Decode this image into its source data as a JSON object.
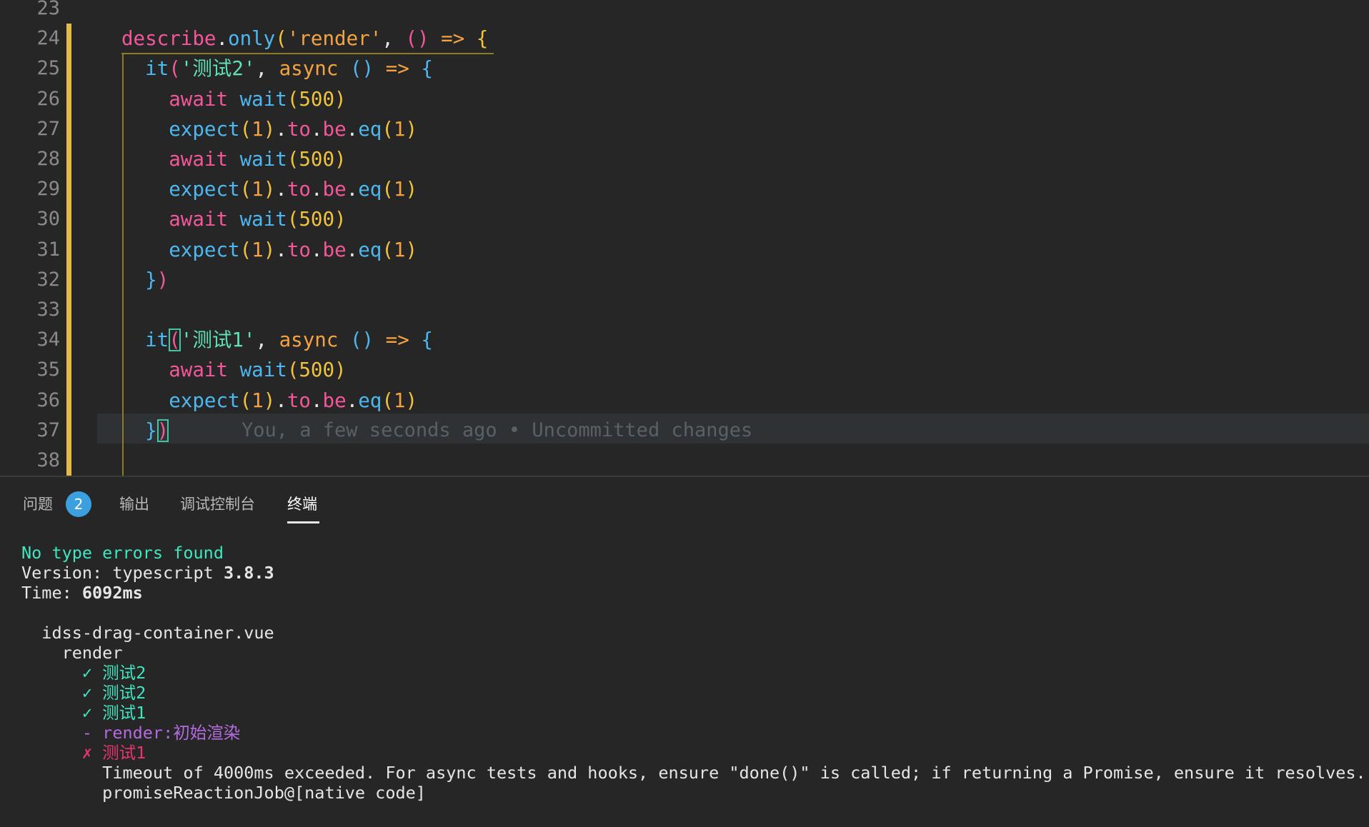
{
  "editor": {
    "lines": [
      {
        "num": "23",
        "tokens": []
      },
      {
        "num": "24",
        "tokens": [
          [
            "describe",
            "t-pink"
          ],
          [
            ".",
            "t-white"
          ],
          [
            "only",
            "t-blue"
          ],
          [
            "(",
            "t-yel"
          ],
          [
            "'render'",
            "t-or"
          ],
          [
            ", ",
            "t-white"
          ],
          [
            "()",
            "t-pink"
          ],
          [
            " => ",
            "t-or"
          ],
          [
            "{",
            "t-yel"
          ]
        ]
      },
      {
        "num": "25",
        "tokens": [
          [
            "  it",
            "t-blue"
          ],
          [
            "(",
            "t-pink"
          ],
          [
            "'测试2'",
            "t-green"
          ],
          [
            ", ",
            "t-white"
          ],
          [
            "async",
            "t-or"
          ],
          [
            " ",
            "t-white"
          ],
          [
            "()",
            "t-blue"
          ],
          [
            " => ",
            "t-or"
          ],
          [
            "{",
            "t-blue"
          ]
        ]
      },
      {
        "num": "26",
        "tokens": [
          [
            "    await",
            "t-pink"
          ],
          [
            " ",
            "t-white"
          ],
          [
            "wait",
            "t-blue"
          ],
          [
            "(",
            "t-yel"
          ],
          [
            "500",
            "t-yel"
          ],
          [
            ")",
            "t-yel"
          ]
        ]
      },
      {
        "num": "27",
        "tokens": [
          [
            "    expect",
            "t-blue"
          ],
          [
            "(",
            "t-yel"
          ],
          [
            "1",
            "t-or"
          ],
          [
            ")",
            "t-yel"
          ],
          [
            ".",
            "t-white"
          ],
          [
            "to",
            "t-pink"
          ],
          [
            ".",
            "t-white"
          ],
          [
            "be",
            "t-pink"
          ],
          [
            ".",
            "t-white"
          ],
          [
            "eq",
            "t-blue"
          ],
          [
            "(",
            "t-yel"
          ],
          [
            "1",
            "t-or"
          ],
          [
            ")",
            "t-yel"
          ]
        ]
      },
      {
        "num": "28",
        "tokens": [
          [
            "    await",
            "t-pink"
          ],
          [
            " ",
            "t-white"
          ],
          [
            "wait",
            "t-blue"
          ],
          [
            "(",
            "t-yel"
          ],
          [
            "500",
            "t-yel"
          ],
          [
            ")",
            "t-yel"
          ]
        ]
      },
      {
        "num": "29",
        "tokens": [
          [
            "    expect",
            "t-blue"
          ],
          [
            "(",
            "t-yel"
          ],
          [
            "1",
            "t-or"
          ],
          [
            ")",
            "t-yel"
          ],
          [
            ".",
            "t-white"
          ],
          [
            "to",
            "t-pink"
          ],
          [
            ".",
            "t-white"
          ],
          [
            "be",
            "t-pink"
          ],
          [
            ".",
            "t-white"
          ],
          [
            "eq",
            "t-blue"
          ],
          [
            "(",
            "t-yel"
          ],
          [
            "1",
            "t-or"
          ],
          [
            ")",
            "t-yel"
          ]
        ]
      },
      {
        "num": "30",
        "tokens": [
          [
            "    await",
            "t-pink"
          ],
          [
            " ",
            "t-white"
          ],
          [
            "wait",
            "t-blue"
          ],
          [
            "(",
            "t-yel"
          ],
          [
            "500",
            "t-yel"
          ],
          [
            ")",
            "t-yel"
          ]
        ]
      },
      {
        "num": "31",
        "tokens": [
          [
            "    expect",
            "t-blue"
          ],
          [
            "(",
            "t-yel"
          ],
          [
            "1",
            "t-or"
          ],
          [
            ")",
            "t-yel"
          ],
          [
            ".",
            "t-white"
          ],
          [
            "to",
            "t-pink"
          ],
          [
            ".",
            "t-white"
          ],
          [
            "be",
            "t-pink"
          ],
          [
            ".",
            "t-white"
          ],
          [
            "eq",
            "t-blue"
          ],
          [
            "(",
            "t-yel"
          ],
          [
            "1",
            "t-or"
          ],
          [
            ")",
            "t-yel"
          ]
        ]
      },
      {
        "num": "32",
        "tokens": [
          [
            "  }",
            "t-blue"
          ],
          [
            ")",
            "t-pink"
          ]
        ]
      },
      {
        "num": "33",
        "tokens": []
      },
      {
        "num": "34",
        "tokens": [
          [
            "  it",
            "t-blue"
          ],
          [
            "(",
            "t-pink"
          ],
          [
            "'测试1'",
            "t-green"
          ],
          [
            ", ",
            "t-white"
          ],
          [
            "async",
            "t-or"
          ],
          [
            " ",
            "t-white"
          ],
          [
            "()",
            "t-blue"
          ],
          [
            " => ",
            "t-or"
          ],
          [
            "{",
            "t-blue"
          ]
        ]
      },
      {
        "num": "35",
        "tokens": [
          [
            "    await",
            "t-pink"
          ],
          [
            " ",
            "t-white"
          ],
          [
            "wait",
            "t-blue"
          ],
          [
            "(",
            "t-yel"
          ],
          [
            "500",
            "t-yel"
          ],
          [
            ")",
            "t-yel"
          ]
        ]
      },
      {
        "num": "36",
        "tokens": [
          [
            "    expect",
            "t-blue"
          ],
          [
            "(",
            "t-yel"
          ],
          [
            "1",
            "t-or"
          ],
          [
            ")",
            "t-yel"
          ],
          [
            ".",
            "t-white"
          ],
          [
            "to",
            "t-pink"
          ],
          [
            ".",
            "t-white"
          ],
          [
            "be",
            "t-pink"
          ],
          [
            ".",
            "t-white"
          ],
          [
            "eq",
            "t-blue"
          ],
          [
            "(",
            "t-yel"
          ],
          [
            "1",
            "t-or"
          ],
          [
            ")",
            "t-yel"
          ]
        ]
      },
      {
        "num": "37",
        "tokens": [
          [
            "  }",
            "t-blue"
          ],
          [
            ")",
            "t-pink"
          ]
        ]
      },
      {
        "num": "38",
        "tokens": []
      }
    ],
    "blame": "You, a few seconds ago • Uncommitted changes"
  },
  "panel": {
    "tabs": [
      {
        "label": "问题",
        "active": false
      },
      {
        "label": "输出",
        "active": false
      },
      {
        "label": "调试控制台",
        "active": false
      },
      {
        "label": "终端",
        "active": true
      }
    ],
    "problems_count": "2",
    "terminal": [
      {
        "text": "No type errors found",
        "cls": "term-green"
      },
      {
        "text": "Version: typescript ",
        "cls": "",
        "bold": "3.8.3"
      },
      {
        "text": "Time: ",
        "cls": "",
        "bold": "6092ms"
      },
      {
        "text": "",
        "cls": ""
      },
      {
        "text": "  idss-drag-container.vue",
        "cls": ""
      },
      {
        "text": "    render",
        "cls": ""
      },
      {
        "text": "      ✓ 测试2",
        "cls": "term-pass"
      },
      {
        "text": "      ✓ 测试2",
        "cls": "term-pass"
      },
      {
        "text": "      ✓ 测试1",
        "cls": "term-pass"
      },
      {
        "text": "      - render:初始渲染",
        "cls": "term-pend"
      },
      {
        "text": "      ✗ 测试1",
        "cls": "term-fail"
      },
      {
        "text": "        Timeout of 4000ms exceeded. For async tests and hooks, ensure \"done()\" is called; if returning a Promise, ensure it resolves.",
        "cls": ""
      },
      {
        "text": "        promiseReactionJob@[native code]",
        "cls": ""
      }
    ]
  }
}
